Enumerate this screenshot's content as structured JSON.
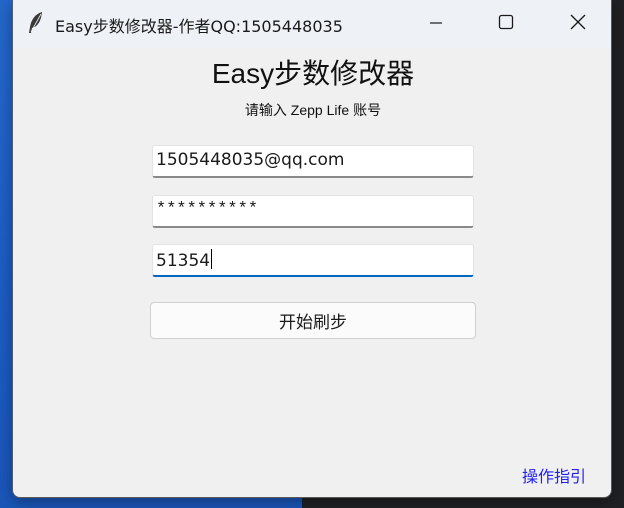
{
  "window": {
    "title": "Easy步数修改器-作者QQ:1505448035",
    "controls": {
      "minimize_icon": "minimize-icon",
      "maximize_icon": "maximize-icon",
      "close_icon": "close-icon"
    },
    "app_icon": "feather-icon"
  },
  "main": {
    "heading_latin": "Easy步",
    "heading_cjk": "数修改器",
    "subtitle": "请输入 Zepp Life 账号",
    "account_value": "1505448035@qq.com",
    "password_value": "**********",
    "steps_value": "51354",
    "start_button": "开始刷步",
    "guide_link": "操作指引"
  },
  "colors": {
    "window_bg": "#f0f0f0",
    "titlebar_bg": "#eef2f6",
    "focus_accent": "#0067c0",
    "link": "#2323e8"
  }
}
